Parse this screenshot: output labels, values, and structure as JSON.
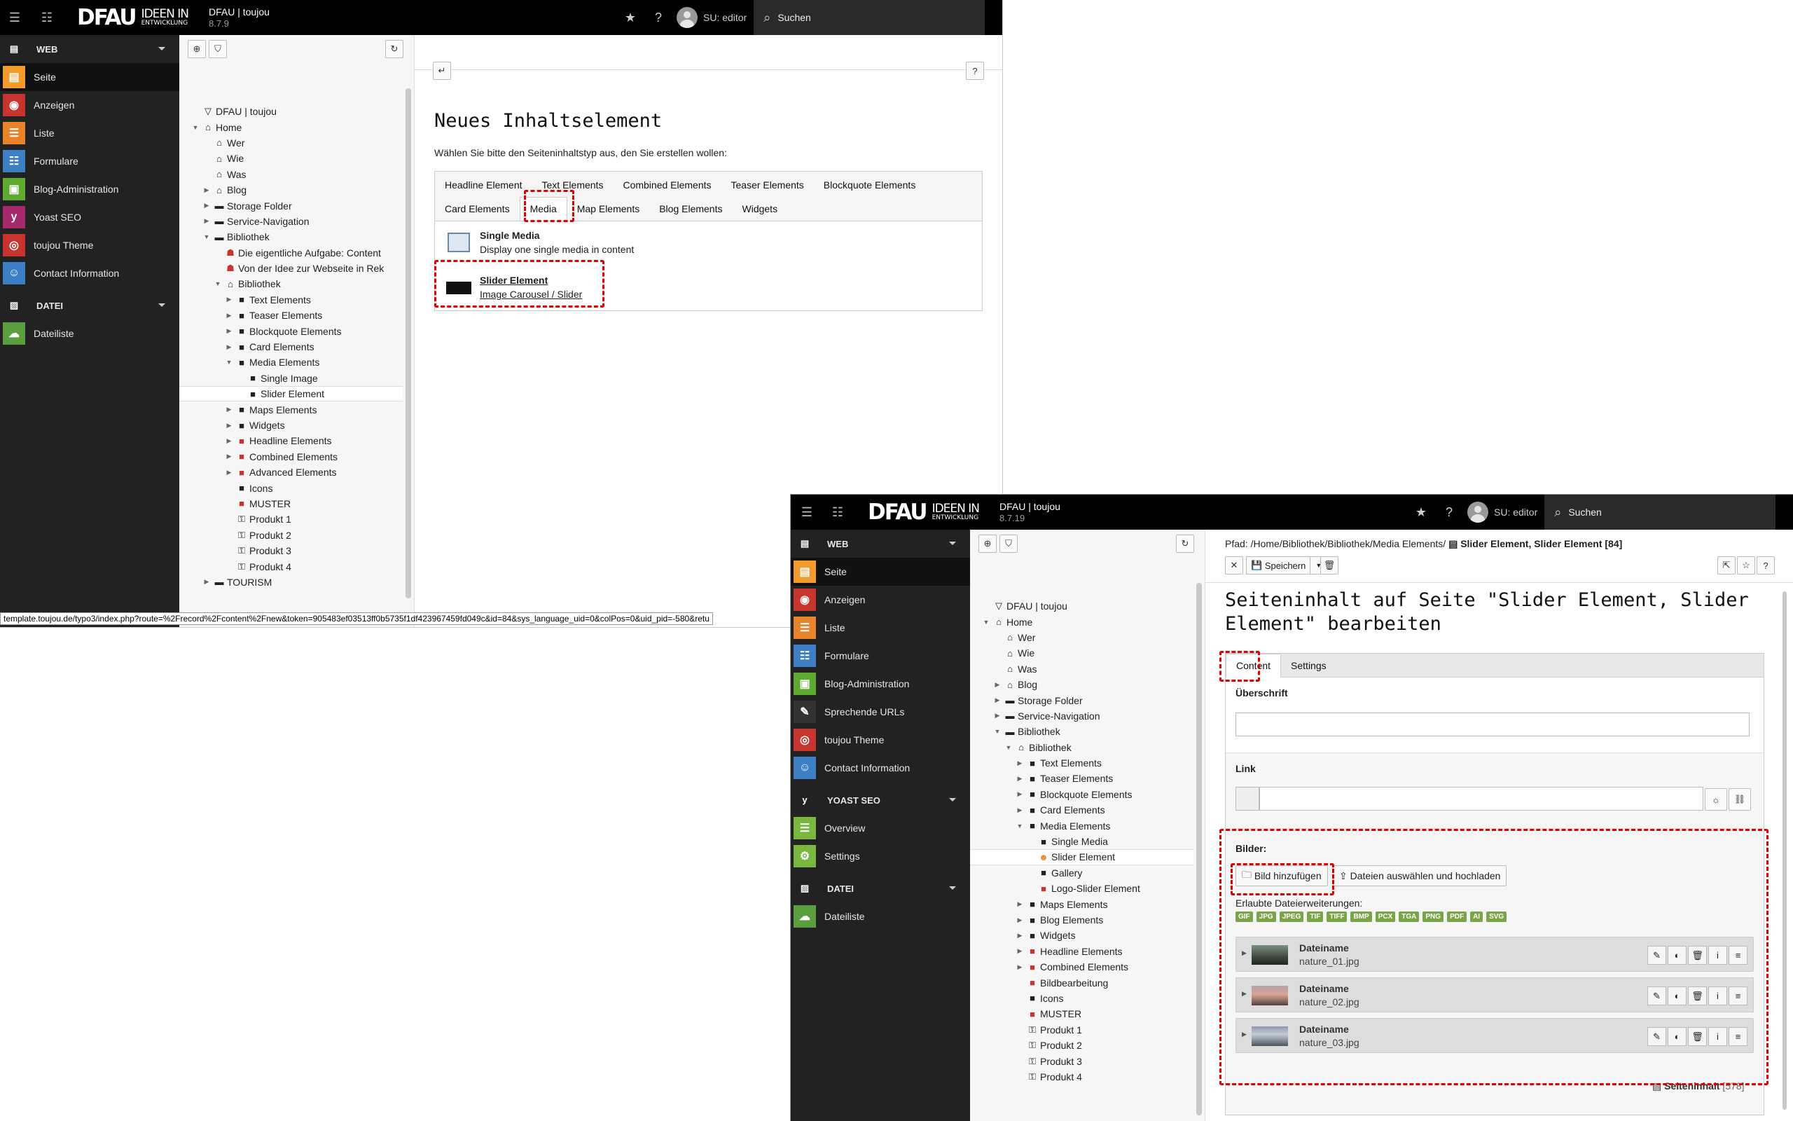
{
  "w1": {
    "brand": {
      "logo": "DFAU",
      "tagline_top": "IDEEN IN",
      "tagline_bottom": "ENTWICKLUNG",
      "site": "DFAU | toujou",
      "version": "8.7.9"
    },
    "user": "SU: editor",
    "search": "Suchen",
    "modules": {
      "web_label": "WEB",
      "items": [
        {
          "label": "Seite",
          "color": "#f29a2a",
          "glyph": "▤"
        },
        {
          "label": "Anzeigen",
          "color": "#c8352f",
          "glyph": "◉"
        },
        {
          "label": "Liste",
          "color": "#e9832a",
          "glyph": "☰"
        },
        {
          "label": "Formulare",
          "color": "#3d7fc4",
          "glyph": "☷"
        },
        {
          "label": "Blog-Administration",
          "color": "#5eaa2e",
          "glyph": "▣"
        },
        {
          "label": "Yoast SEO",
          "color": "#a4286a",
          "glyph": "y"
        },
        {
          "label": "toujou Theme",
          "color": "#c8352f",
          "glyph": "◎"
        },
        {
          "label": "Contact Information",
          "color": "#3d7fc4",
          "glyph": "☺"
        }
      ],
      "datei_label": "DATEI",
      "datei_items": [
        {
          "label": "Dateiliste",
          "color": "#5b9e3f",
          "glyph": "☁"
        }
      ]
    },
    "tree": [
      {
        "label": "DFAU | toujou",
        "depth": 0,
        "toggle": "",
        "icon": "▽"
      },
      {
        "label": "Home",
        "depth": 0,
        "toggle": "▼",
        "icon": "⌂"
      },
      {
        "label": "Wer",
        "depth": 1,
        "toggle": "",
        "icon": "⌂"
      },
      {
        "label": "Wie",
        "depth": 1,
        "toggle": "",
        "icon": "⌂"
      },
      {
        "label": "Was",
        "depth": 1,
        "toggle": "",
        "icon": "⌂"
      },
      {
        "label": "Blog",
        "depth": 1,
        "toggle": "▶",
        "icon": "⌂"
      },
      {
        "label": "Storage Folder",
        "depth": 1,
        "toggle": "▶",
        "icon": "▬"
      },
      {
        "label": "Service-Navigation",
        "depth": 1,
        "toggle": "▶",
        "icon": "▬"
      },
      {
        "label": "Bibliothek",
        "depth": 1,
        "toggle": "▼",
        "icon": "▬"
      },
      {
        "label": "Die eigentliche Aufgabe: Content",
        "depth": 2,
        "toggle": "",
        "icon": "☗"
      },
      {
        "label": "Von der Idee zur Webseite in Rek",
        "depth": 2,
        "toggle": "",
        "icon": "☗"
      },
      {
        "label": "Bibliothek",
        "depth": 2,
        "toggle": "▼",
        "icon": "⌂"
      },
      {
        "label": "Text Elements",
        "depth": 3,
        "toggle": "▶",
        "icon": "■"
      },
      {
        "label": "Teaser Elements",
        "depth": 3,
        "toggle": "▶",
        "icon": "■"
      },
      {
        "label": "Blockquote Elements",
        "depth": 3,
        "toggle": "▶",
        "icon": "■"
      },
      {
        "label": "Card Elements",
        "depth": 3,
        "toggle": "▶",
        "icon": "■"
      },
      {
        "label": "Media Elements",
        "depth": 3,
        "toggle": "▼",
        "icon": "■"
      },
      {
        "label": "Single Image",
        "depth": 4,
        "toggle": "",
        "icon": "■"
      },
      {
        "label": "Slider Element",
        "depth": 4,
        "toggle": "",
        "icon": "■",
        "selected": true
      },
      {
        "label": "Maps Elements",
        "depth": 3,
        "toggle": "▶",
        "icon": "■"
      },
      {
        "label": "Widgets",
        "depth": 3,
        "toggle": "▶",
        "icon": "■"
      },
      {
        "label": "Headline Elements",
        "depth": 3,
        "toggle": "▶",
        "icon": "■"
      },
      {
        "label": "Combined Elements",
        "depth": 3,
        "toggle": "▶",
        "icon": "■"
      },
      {
        "label": "Advanced Elements",
        "depth": 3,
        "toggle": "▶",
        "icon": "■"
      },
      {
        "label": "Icons",
        "depth": 3,
        "toggle": "",
        "icon": "■"
      },
      {
        "label": "MUSTER",
        "depth": 3,
        "toggle": "",
        "icon": "■"
      },
      {
        "label": "Produkt 1",
        "depth": 3,
        "toggle": "",
        "icon": "⚿"
      },
      {
        "label": "Produkt 2",
        "depth": 3,
        "toggle": "",
        "icon": "⚿"
      },
      {
        "label": "Produkt 3",
        "depth": 3,
        "toggle": "",
        "icon": "⚿"
      },
      {
        "label": "Produkt 4",
        "depth": 3,
        "toggle": "",
        "icon": "⚿"
      },
      {
        "label": "TOURISM",
        "depth": 1,
        "toggle": "▶",
        "icon": "▬"
      }
    ],
    "status_url": "template.toujou.de/typo3/index.php?route=%2Frecord%2Fcontent%2Fnew&token=905483ef03513ff0b5735f1df423967459fd049c&id=84&sys_language_uid=0&colPos=0&uid_pid=-580&retu",
    "content": {
      "title": "Neues Inhaltselement",
      "intro": "Wählen Sie bitte den Seiteninhaltstyp aus, den Sie erstellen wollen:",
      "tabs_row1": [
        "Headline Element",
        "Text Elements",
        "Combined Elements",
        "Teaser Elements",
        "Blockquote Elements"
      ],
      "tabs_row2": [
        "Card Elements",
        "Media",
        "Map Elements",
        "Blog Elements",
        "Widgets"
      ],
      "active_tab": "Media",
      "wizard": [
        {
          "title": "Single Media",
          "desc": "Display one single media in content"
        },
        {
          "title": "Slider Element",
          "desc": "Image Carousel / Slider"
        }
      ],
      "help": "?"
    }
  },
  "w2": {
    "brand": {
      "logo": "DFAU",
      "tagline_top": "IDEEN IN",
      "tagline_bottom": "ENTWICKLUNG",
      "site": "DFAU | toujou",
      "version": "8.7.19"
    },
    "user": "SU: editor",
    "search": "Suchen",
    "modules": {
      "web_label": "WEB",
      "items": [
        {
          "label": "Seite",
          "color": "#f29a2a",
          "glyph": "▤"
        },
        {
          "label": "Anzeigen",
          "color": "#c8352f",
          "glyph": "◉"
        },
        {
          "label": "Liste",
          "color": "#e9832a",
          "glyph": "☰"
        },
        {
          "label": "Formulare",
          "color": "#3d7fc4",
          "glyph": "☷"
        },
        {
          "label": "Blog-Administration",
          "color": "#5eaa2e",
          "glyph": "▣"
        },
        {
          "label": "Sprechende URLs",
          "color": "#333333",
          "glyph": "✎"
        },
        {
          "label": "toujou Theme",
          "color": "#c8352f",
          "glyph": "◎"
        },
        {
          "label": "Contact Information",
          "color": "#3d7fc4",
          "glyph": "☺"
        }
      ],
      "yoast_label": "YOAST SEO",
      "yoast_items": [
        {
          "label": "Overview",
          "color": "#79b83e",
          "glyph": "☰"
        },
        {
          "label": "Settings",
          "color": "#79b83e",
          "glyph": "⚙"
        }
      ],
      "datei_label": "DATEI",
      "datei_items": [
        {
          "label": "Dateiliste",
          "color": "#5b9e3f",
          "glyph": "☁"
        }
      ]
    },
    "tree": [
      {
        "label": "DFAU | toujou",
        "depth": 0,
        "toggle": "",
        "icon": "▽"
      },
      {
        "label": "Home",
        "depth": 0,
        "toggle": "▼",
        "icon": "⌂"
      },
      {
        "label": "Wer",
        "depth": 1,
        "toggle": "",
        "icon": "⌂"
      },
      {
        "label": "Wie",
        "depth": 1,
        "toggle": "",
        "icon": "⌂"
      },
      {
        "label": "Was",
        "depth": 1,
        "toggle": "",
        "icon": "⌂"
      },
      {
        "label": "Blog",
        "depth": 1,
        "toggle": "▶",
        "icon": "⌂"
      },
      {
        "label": "Storage Folder",
        "depth": 1,
        "toggle": "▶",
        "icon": "▬"
      },
      {
        "label": "Service-Navigation",
        "depth": 1,
        "toggle": "▶",
        "icon": "▬"
      },
      {
        "label": "Bibliothek",
        "depth": 1,
        "toggle": "▼",
        "icon": "▬"
      },
      {
        "label": "Bibliothek",
        "depth": 2,
        "toggle": "▼",
        "icon": "⌂"
      },
      {
        "label": "Text Elements",
        "depth": 3,
        "toggle": "▶",
        "icon": "■"
      },
      {
        "label": "Teaser Elements",
        "depth": 3,
        "toggle": "▶",
        "icon": "■"
      },
      {
        "label": "Blockquote Elements",
        "depth": 3,
        "toggle": "▶",
        "icon": "■"
      },
      {
        "label": "Card Elements",
        "depth": 3,
        "toggle": "▶",
        "icon": "■"
      },
      {
        "label": "Media Elements",
        "depth": 3,
        "toggle": "▼",
        "icon": "■"
      },
      {
        "label": "Single Media",
        "depth": 4,
        "toggle": "",
        "icon": "■"
      },
      {
        "label": "Slider Element",
        "depth": 4,
        "toggle": "",
        "icon": "☻",
        "selected": true
      },
      {
        "label": "Gallery",
        "depth": 4,
        "toggle": "",
        "icon": "■"
      },
      {
        "label": "Logo-Slider Element",
        "depth": 4,
        "toggle": "",
        "icon": "■"
      },
      {
        "label": "Maps Elements",
        "depth": 3,
        "toggle": "▶",
        "icon": "■"
      },
      {
        "label": "Blog Elements",
        "depth": 3,
        "toggle": "▶",
        "icon": "■"
      },
      {
        "label": "Widgets",
        "depth": 3,
        "toggle": "▶",
        "icon": "■"
      },
      {
        "label": "Headline Elements",
        "depth": 3,
        "toggle": "▶",
        "icon": "■"
      },
      {
        "label": "Combined Elements",
        "depth": 3,
        "toggle": "▶",
        "icon": "■"
      },
      {
        "label": "Bildbearbeitung",
        "depth": 3,
        "toggle": "",
        "icon": "■"
      },
      {
        "label": "Icons",
        "depth": 3,
        "toggle": "",
        "icon": "■"
      },
      {
        "label": "MUSTER",
        "depth": 3,
        "toggle": "",
        "icon": "■"
      },
      {
        "label": "Produkt 1",
        "depth": 3,
        "toggle": "",
        "icon": "⚿"
      },
      {
        "label": "Produkt 2",
        "depth": 3,
        "toggle": "",
        "icon": "⚿"
      },
      {
        "label": "Produkt 3",
        "depth": 3,
        "toggle": "",
        "icon": "⚿"
      },
      {
        "label": "Produkt 4",
        "depth": 3,
        "toggle": "",
        "icon": "⚿"
      }
    ],
    "content": {
      "path_prefix": "Pfad: /Home/Bibliothek/Bibliothek/Media Elements/",
      "path_record": "Slider Element, Slider Element [84]",
      "save_label": "Speichern",
      "title": "Seiteninhalt auf Seite \"Slider Element, Slider Element\" bearbeiten",
      "tabs": [
        "Content",
        "Settings"
      ],
      "active_tab": "Content",
      "field_headline": "Überschrift",
      "field_link": "Link",
      "field_images": "Bilder:",
      "add_image": "Bild hinzufügen",
      "upload": "Dateien auswählen und hochladen",
      "allowed_label": "Erlaubte Dateierweiterungen:",
      "extensions": [
        "GIF",
        "JPG",
        "JPEG",
        "TIF",
        "TIFF",
        "BMP",
        "PCX",
        "TGA",
        "PNG",
        "PDF",
        "AI",
        "SVG"
      ],
      "files_label": "Dateiname",
      "files": [
        "nature_01.jpg",
        "nature_02.jpg",
        "nature_03.jpg"
      ],
      "footer_record": "Seiteninhalt",
      "footer_id": "[578]"
    }
  }
}
